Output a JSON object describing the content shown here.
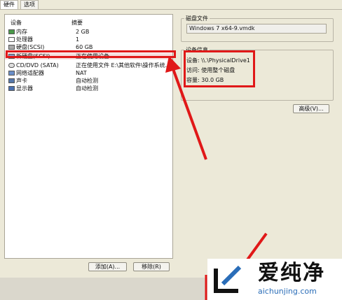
{
  "tabs": [
    "硬件",
    "选项"
  ],
  "device_list": {
    "headers": {
      "device": "设备",
      "summary": "摘要"
    },
    "rows": [
      {
        "name": "内存",
        "summary": "2 GB",
        "icon": "memory-icon"
      },
      {
        "name": "处理器",
        "summary": "1",
        "icon": "cpu-icon"
      },
      {
        "name": "硬盘(SCSI)",
        "summary": "60 GB",
        "icon": "harddisk-icon"
      },
      {
        "name": "新硬盘(SCSI)",
        "summary": "正在使用设备",
        "icon": "harddisk-icon",
        "selected": true
      },
      {
        "name": "CD/DVD (SATA)",
        "summary": "正在使用文件 E:\\其他软件\\操作系统...",
        "icon": "cdrom-icon"
      },
      {
        "name": "网络适配器",
        "summary": "NAT",
        "icon": "network-icon"
      },
      {
        "name": "声卡",
        "summary": "自动检测",
        "icon": "speaker-icon"
      },
      {
        "name": "显示器",
        "summary": "自动检测",
        "icon": "monitor-icon"
      }
    ]
  },
  "buttons": {
    "add": "添加(A)...",
    "remove": "移除(R)",
    "advanced": "高级(V)..."
  },
  "disk_file": {
    "title": "磁盘文件",
    "value": "Windows 7 x64-9.vmdk"
  },
  "device_info": {
    "title": "设备信息",
    "device": "设备: \\\\.\\PhysicalDrive1",
    "access": "访问: 使用整个磁盘",
    "capacity": "容量: 30.0 GB"
  },
  "watermark": {
    "cn": "爱纯净",
    "en": "aichunjing.com"
  },
  "colors": {
    "annotation": "#e01818",
    "background": "#ece9d8"
  }
}
